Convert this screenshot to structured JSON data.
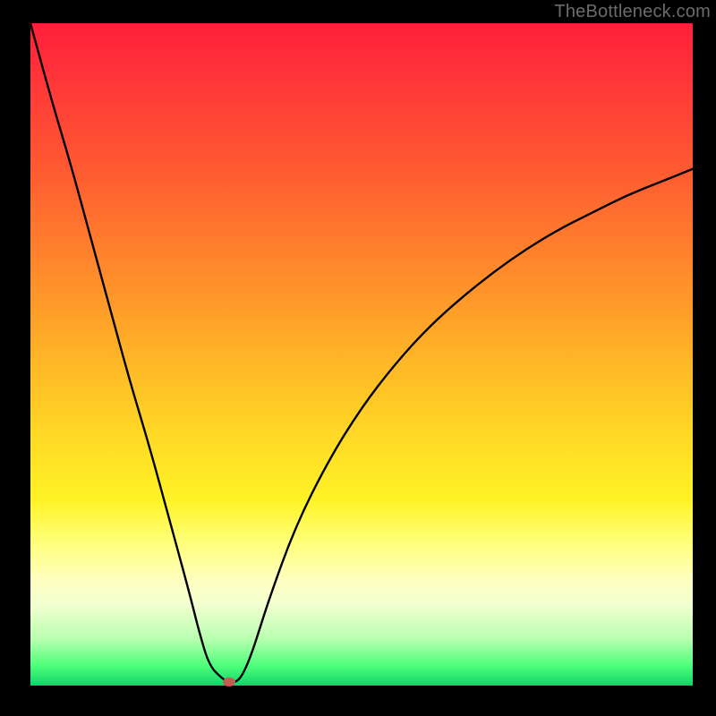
{
  "header": {
    "watermark": "TheBottleneck.com"
  },
  "colors": {
    "background": "#000000",
    "watermark": "#6b6b6b",
    "curve": "#000000",
    "dot": "#c85a52",
    "gradient_top": "#ff1f3a",
    "gradient_bottom": "#12d36a"
  },
  "chart_data": {
    "type": "line",
    "title": "",
    "xlabel": "",
    "ylabel": "",
    "xlim": [
      0,
      100
    ],
    "ylim": [
      0,
      100
    ],
    "grid": false,
    "legend": false,
    "x": [
      0,
      3,
      6,
      9,
      12,
      15,
      18,
      21,
      24,
      25.5,
      27,
      29,
      30,
      31,
      32,
      33.5,
      36,
      40,
      45,
      50,
      55,
      60,
      65,
      70,
      75,
      80,
      85,
      90,
      95,
      100
    ],
    "values": [
      100,
      89,
      79,
      68,
      57,
      46,
      36,
      25,
      14,
      8,
      3,
      1,
      0.5,
      0.5,
      1.5,
      5,
      13,
      24,
      34,
      42,
      48.5,
      54,
      58.5,
      62.5,
      66,
      69,
      71.5,
      74,
      76,
      78
    ],
    "marker": {
      "x": 30,
      "y": 0.5
    },
    "note": "Values estimated from pixel positions; y=0 at bottom (green), y=100 at top (red)."
  }
}
